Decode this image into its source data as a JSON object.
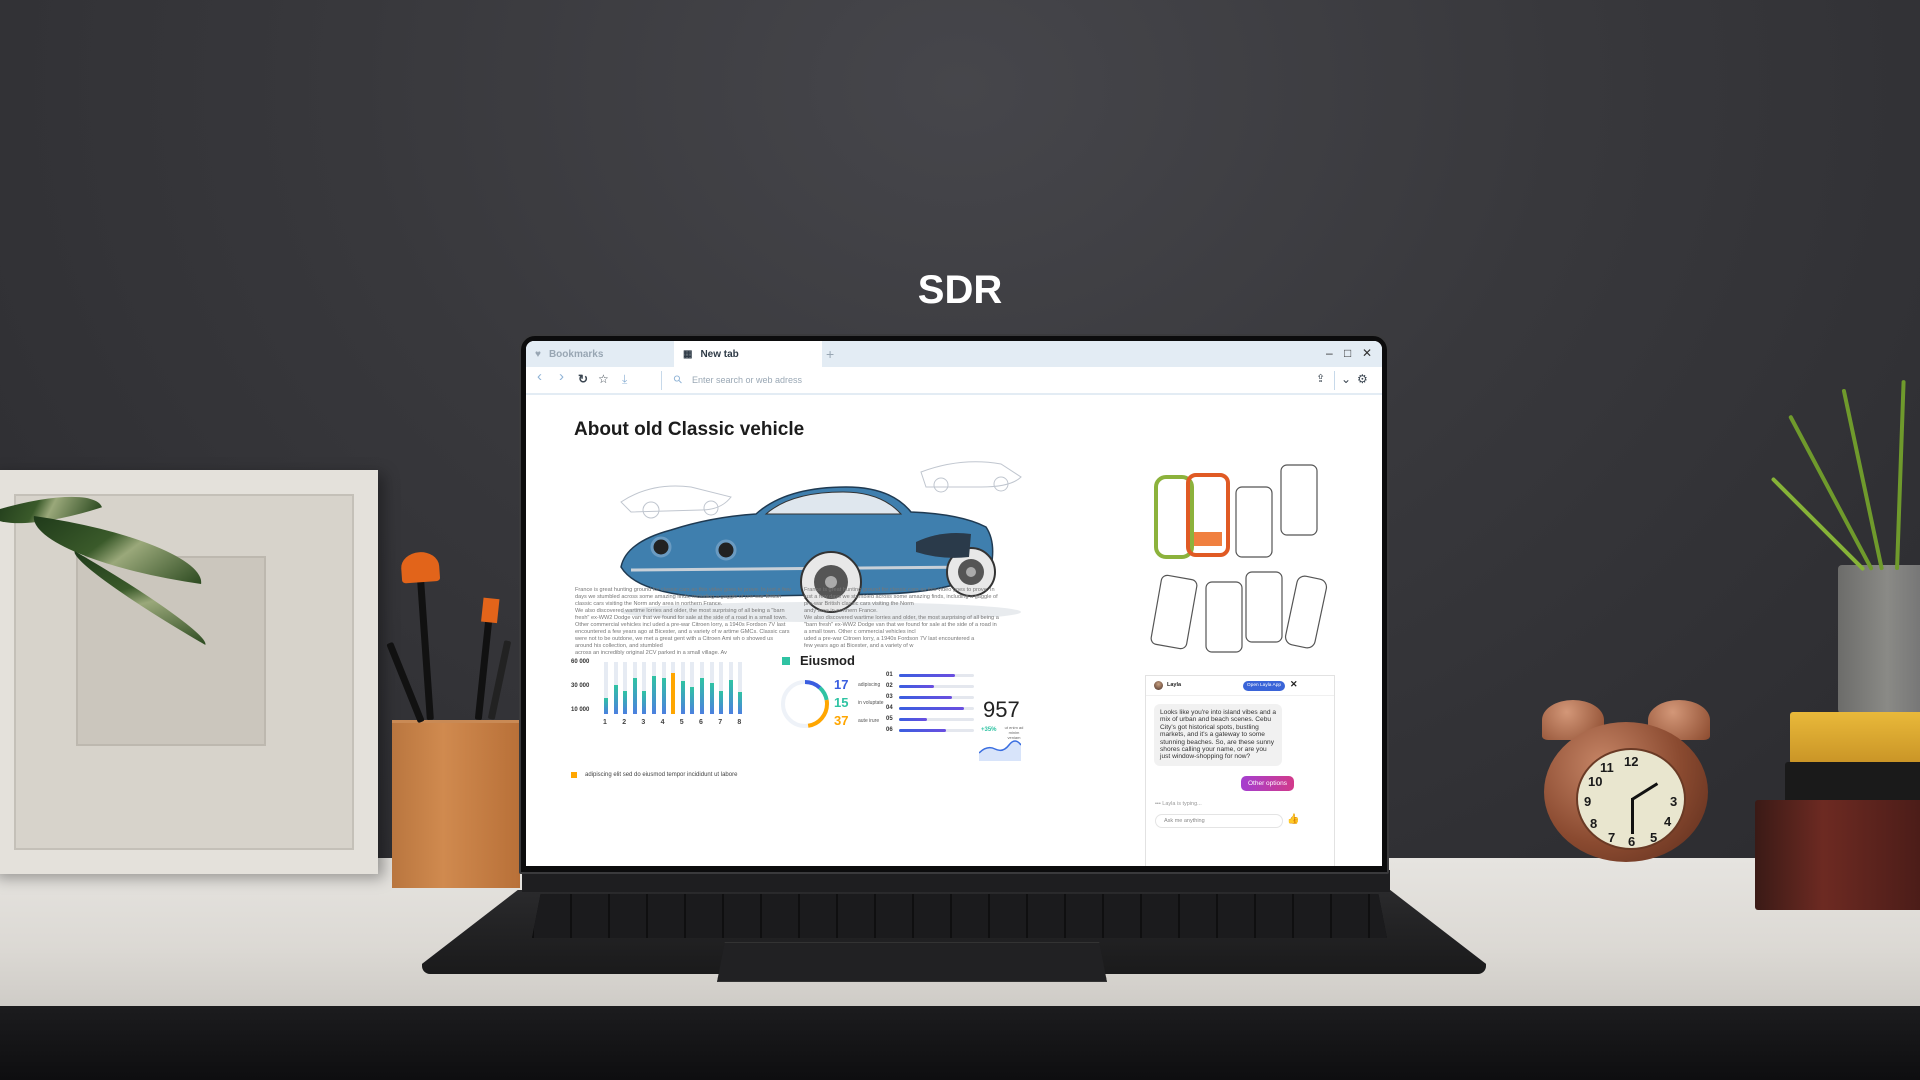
{
  "scene": {
    "label": "SDR",
    "colors": {
      "wall": "#38383c",
      "desk": "#e2dfda",
      "accent_teal": "#2fc3a3",
      "accent_blue": "#4c7fe0",
      "accent_orange": "#ffa600",
      "accent_purple": "#a43fd0"
    }
  },
  "browser": {
    "tabs": [
      {
        "label": "Bookmarks",
        "icon": "heart-icon",
        "active": false
      },
      {
        "label": "New tab",
        "icon": "grid-icon",
        "active": true
      }
    ],
    "new_tab_icon": "+",
    "window_controls": {
      "minimize": "–",
      "maximize": "□",
      "close": "✕"
    },
    "toolbar": {
      "back_icon": "‹",
      "forward_icon": "›",
      "reload_icon": "↻",
      "bookmark_icon": "☆",
      "download_icon": "⤓",
      "search_icon": "⚲",
      "address_placeholder": "Enter search or web adress",
      "share_icon": "⇪",
      "menu_icon": "⌄",
      "settings_icon": "⚙"
    }
  },
  "page": {
    "title": "About old Classic vehicle",
    "paragraph_left": "France is great hunting ground for classic cars as this video goes to prove. In just a few days we stumbled across some amazing finds, including a gaggle of pre-war British classic cars visiting the Norm andy area in northern France.\nWe also discovered wartime lorries and older, the most surprising of all being a \"barn fresh\" ex-WW2 Dodge van that we found for sale at the side of a road in a small town. Other commercial vehicles incl uded a pre-war Citroen lorry, a 1940s Fordson 7V last encountered a few years ago at Bicester, and a variety of w artime GMCs. Classic cars were not to be outdone, we met a great gent with a Citroen Ami wh o showed us around his collection, and stumbled\nacross an incredibly original 2CV parked in a small village. Av",
    "paragraph_right": "France is great hunting ground for classic cars as this video goes to prove. In just a few days we stumbled across some amazing finds, including a gaggle of pre-war British classic cars visiting the Norm\nandy area in northern France.\nWe also discovered wartime lorries and older, the most surprising of all being a \"barn fresh\" ex-WW2 Dodge van that we found for sale at the side of a road in a small town. Other c ommercial vehicles incl\nuded a pre-war Citroen lorry, a 1940s Fordson 7V last encountered a\nfew years ago at Bicester, and a variety of w",
    "legend_label": "adipiscing elit sed do eiusmod tempor incididunt ut labore",
    "eiusmod": {
      "title": "Eiusmod",
      "stats": [
        {
          "value": "17",
          "label": "adipiscing",
          "color": "#3a5ee0"
        },
        {
          "value": "15",
          "label": "in voluptate",
          "color": "#2fc3a3"
        },
        {
          "value": "37",
          "label": "aute irure",
          "color": "#ffa600"
        }
      ],
      "progress": [
        {
          "label": "01",
          "value": 0.74
        },
        {
          "label": "02",
          "value": 0.46
        },
        {
          "label": "03",
          "value": 0.71
        },
        {
          "label": "04",
          "value": 0.87
        },
        {
          "label": "05",
          "value": 0.37
        },
        {
          "label": "06",
          "value": 0.62
        }
      ],
      "big_number": "957",
      "change": "+35%",
      "change_label": "ut enim ad minim veniam"
    }
  },
  "chat": {
    "name": "Layla",
    "open_app_label": "Open Layla App",
    "close_icon": "✕",
    "message": "Looks like you're into island vibes and a mix of urban and beach scenes. Cebu City's got historical spots, bustling markets, and it's a gateway to some stunning beaches. So, are these sunny shores calling your name, or are you just window-shopping for now?",
    "other_options_label": "Other options",
    "typing_status": "••• Layla is typing...",
    "input_placeholder": "Ask me anything",
    "like_icon": "👍"
  },
  "chart_data": {
    "type": "bar",
    "title": "",
    "xlabel": "",
    "ylabel": "",
    "y_tick_labels": [
      "60 000",
      "30 000",
      "10 000"
    ],
    "x_tick_labels": [
      "1",
      "2",
      "3",
      "4",
      "5",
      "6",
      "7",
      "8"
    ],
    "ylim": [
      0,
      60000
    ],
    "series": [
      {
        "name": "adipiscing elit sed do eiusmod tempor incididunt ut labore",
        "values": [
          18000,
          33000,
          27000,
          41000,
          27000,
          44000,
          41000,
          47000,
          38000,
          31000,
          41000,
          36000,
          27000,
          39000,
          25000
        ]
      }
    ],
    "highlight_index": 7,
    "grid": false,
    "legend": "bottom-left"
  },
  "donut_data": {
    "type": "pie",
    "segments": [
      {
        "label": "adipiscing",
        "value": 17,
        "color": "#3a5ee0"
      },
      {
        "label": "in voluptate",
        "value": 15,
        "color": "#2fc3a3"
      },
      {
        "label": "aute irure",
        "value": 37,
        "color": "#ffa600"
      }
    ]
  }
}
